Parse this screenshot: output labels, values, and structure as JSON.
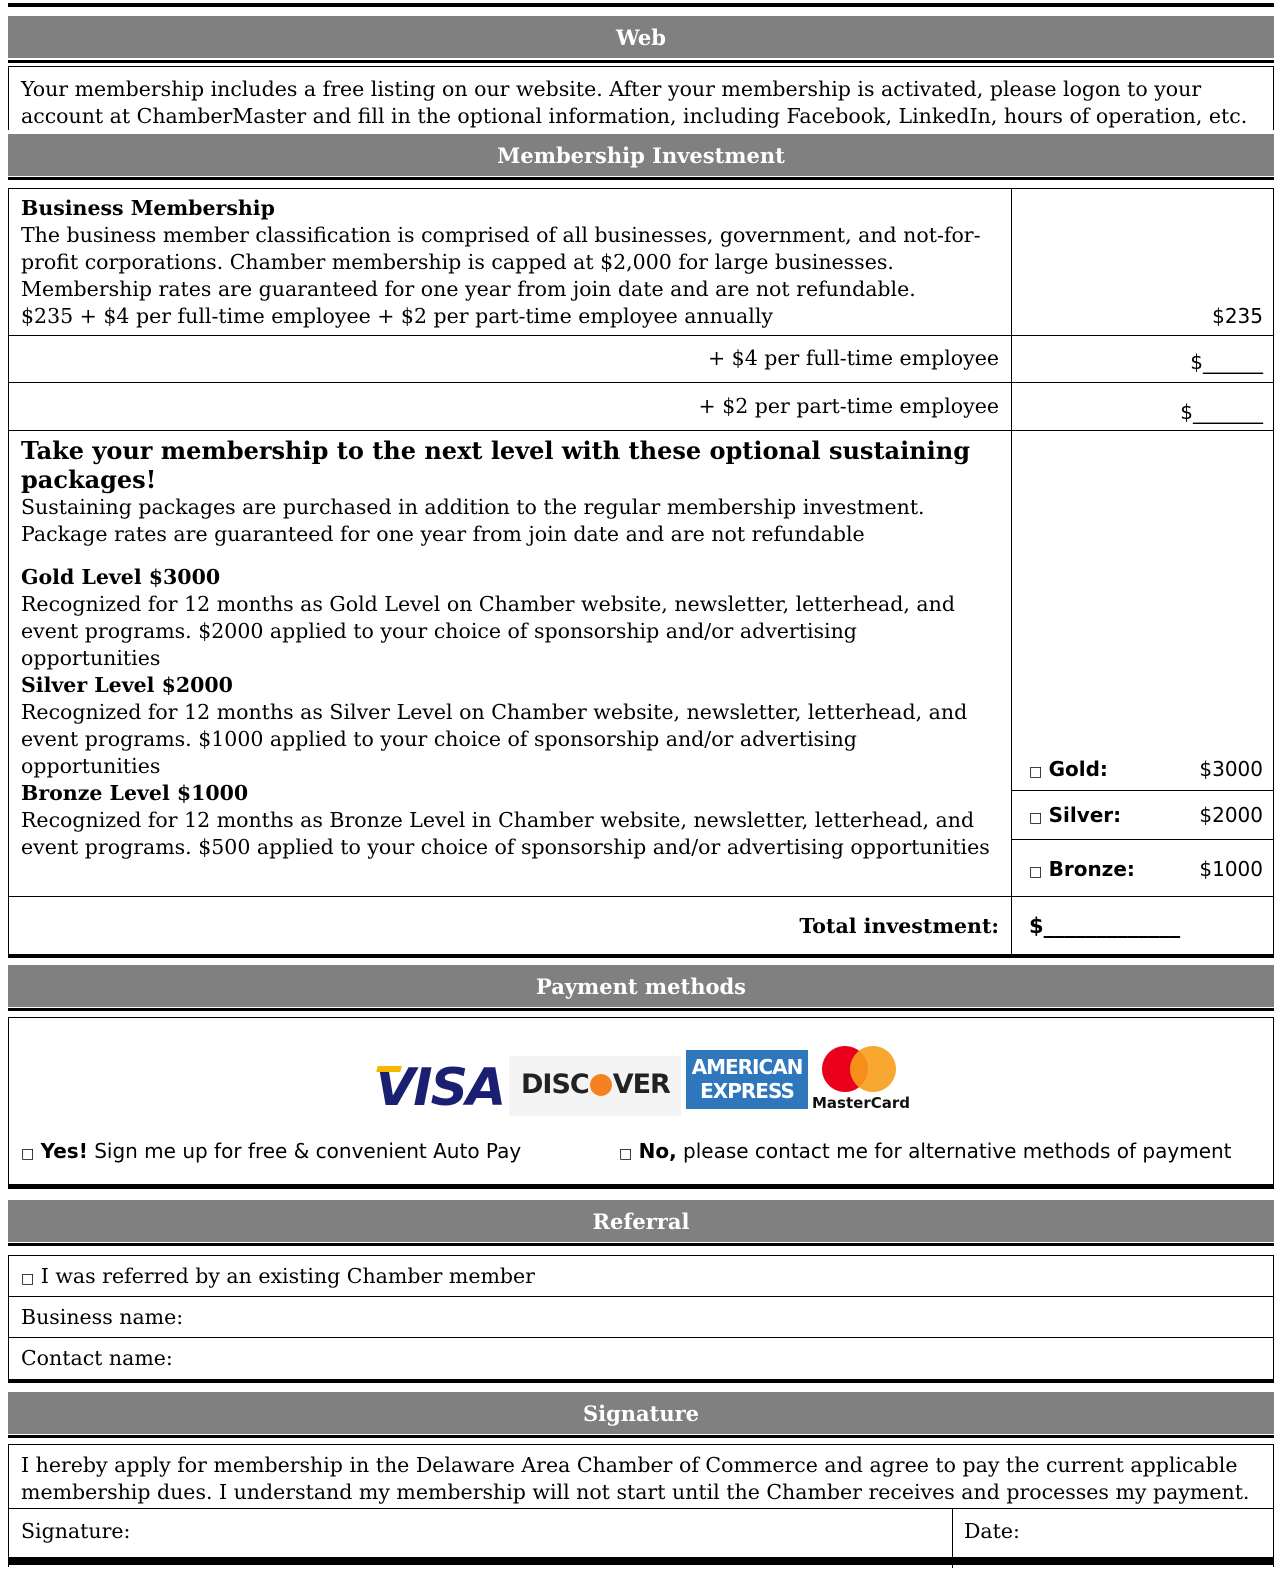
{
  "web": {
    "header": "Web",
    "text": "Your membership includes a free listing on our website. After your membership is activated, please logon to your account at ChamberMaster and fill in the optional information, including Facebook, LinkedIn, hours of operation, etc."
  },
  "investment": {
    "header": "Membership Investment",
    "business": {
      "title": "Business Membership",
      "desc": "The business member classification is comprised of all businesses, government, and not-for-profit corporations. Chamber membership is capped at $2,000 for large businesses. Membership rates are guaranteed for one year from join date and are not refundable.",
      "formula": "$235 + $4 per full-time employee + $2 per part-time employee annually",
      "amount": "$235"
    },
    "full_time": {
      "label": "+ $4 per full-time employee",
      "amount": "$______"
    },
    "part_time": {
      "label": "+ $2 per part-time employee",
      "amount": "$_______"
    },
    "sustaining": {
      "title": "Take your membership to the next level with these optional sustaining packages!",
      "desc": "Sustaining packages are purchased in addition to the regular membership investment. Package rates are guaranteed for one year from join date and are not refundable",
      "gold": {
        "title": "Gold Level $3000",
        "desc": "Recognized for 12 months as Gold Level on Chamber website, newsletter, letterhead, and event programs. $2000 applied to your choice of sponsorship and/or advertising opportunities"
      },
      "silver": {
        "title": "Silver Level $2000",
        "desc": "Recognized for 12 months as Silver Level on Chamber website, newsletter, letterhead, and event programs. $1000 applied to your choice of sponsorship and/or advertising opportunities"
      },
      "bronze": {
        "title": "Bronze Level $1000",
        "desc": "Recognized for 12 months as Bronze Level in Chamber website, newsletter, letterhead, and event programs. $500 applied to your choice of sponsorship and/or advertising opportunities"
      }
    },
    "options": [
      {
        "checkbox": "□",
        "label": "Gold:",
        "price": "$3000"
      },
      {
        "checkbox": "□",
        "label": "Silver:",
        "price": "$2000"
      },
      {
        "checkbox": "□",
        "label": "Bronze:",
        "price": "$1000"
      }
    ],
    "total": {
      "label": "Total investment:",
      "amount": "$_____________"
    }
  },
  "payment": {
    "header": "Payment methods",
    "logos": {
      "visa": "VISA",
      "discover_1": "DISC",
      "discover_2": "VER",
      "amex_1": "AMERICAN",
      "amex_2": "EXPRESS",
      "mastercard": "MasterCard"
    },
    "yes": {
      "checkbox": "□",
      "bold": "Yes!",
      "text": "Sign me up for free & convenient Auto Pay"
    },
    "no": {
      "checkbox": "□",
      "bold": "No,",
      "text": "please contact me for alternative methods of payment"
    }
  },
  "referral": {
    "header": "Referral",
    "checkbox": "□",
    "referred": "I was referred by an existing Chamber member",
    "business_name": "Business name:",
    "contact_name": "Contact name:"
  },
  "signature": {
    "header": "Signature",
    "text": "I hereby apply for membership in the Delaware Area Chamber of Commerce and agree to pay the current applicable membership dues. I understand my membership will not start until the Chamber receives and processes my payment.",
    "signature_label": "Signature:",
    "date_label": "Date:"
  },
  "colors": {
    "header_bg": "#808080",
    "visa_blue": "#1a1f71",
    "visa_gold": "#f7b600",
    "discover_orange": "#f58220",
    "amex_blue": "#2e77bc",
    "mc_red": "#eb001b",
    "mc_orange": "#f79e1b"
  }
}
